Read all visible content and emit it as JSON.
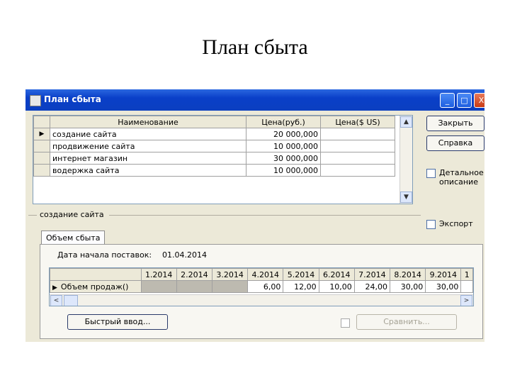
{
  "slide": {
    "title": "План сбыта"
  },
  "window": {
    "title": "План сбыта",
    "controls": {
      "minimize": "_",
      "maximize": "□",
      "close": "X"
    }
  },
  "products_table": {
    "columns": [
      "Наименование",
      "Цена(руб.)",
      "Цена($ US)"
    ],
    "rows": [
      {
        "name": "создание сайта",
        "price_rub": "20 000,000",
        "price_usd": ""
      },
      {
        "name": "продвижение сайта",
        "price_rub": "10 000,000",
        "price_usd": ""
      },
      {
        "name": "интернет магазин",
        "price_rub": "30 000,000",
        "price_usd": ""
      },
      {
        "name": "водержка сайта",
        "price_rub": "10 000,000",
        "price_usd": ""
      }
    ],
    "selected_indicator": "▶"
  },
  "buttons": {
    "close": "Закрыть",
    "help": "Справка",
    "quick_input": "Быстрый ввод...",
    "compare": "Сравнить..."
  },
  "checkboxes": {
    "detailed_description": "Детальное описание",
    "export": "Экспорт"
  },
  "group": {
    "title": "создание сайта"
  },
  "tab": {
    "label": "Объем сбыта"
  },
  "start_date": {
    "label": "Дата начала поставок:",
    "value": "01.04.2014"
  },
  "sales_grid": {
    "months": [
      "1.2014",
      "2.2014",
      "3.2014",
      "4.2014",
      "5.2014",
      "6.2014",
      "7.2014",
      "8.2014",
      "9.2014",
      "1"
    ],
    "row_label": "Объем продаж()",
    "values": [
      "",
      "",
      "",
      "6,00",
      "12,00",
      "10,00",
      "24,00",
      "30,00",
      "30,00",
      ""
    ],
    "indicator": "▶"
  },
  "scroll": {
    "up": "▲",
    "down": "▼",
    "left": "<",
    "right": ">"
  }
}
